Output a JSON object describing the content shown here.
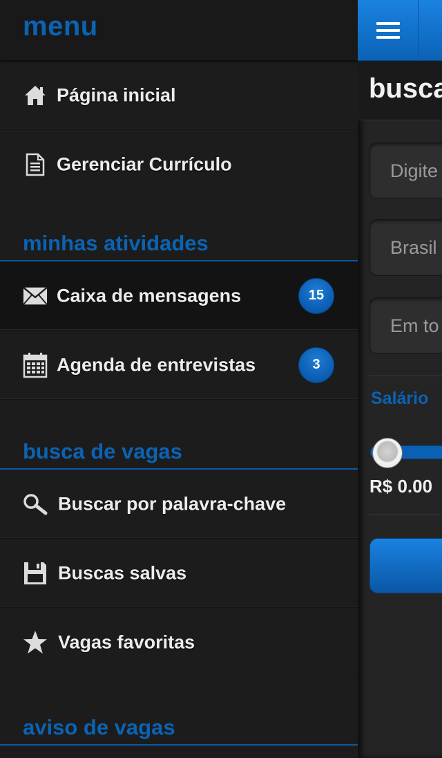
{
  "drawer": {
    "title": "menu",
    "items_top": [
      {
        "label": "Página inicial",
        "icon": "home-icon"
      },
      {
        "label": "Gerenciar Currículo",
        "icon": "document-icon"
      }
    ],
    "sections": [
      {
        "title": "minhas atividades",
        "items": [
          {
            "label": "Caixa de mensagens",
            "icon": "envelope-icon",
            "badge": "15"
          },
          {
            "label": "Agenda de entrevistas",
            "icon": "calendar-icon",
            "badge": "3"
          }
        ]
      },
      {
        "title": "busca de vagas",
        "items": [
          {
            "label": "Buscar por palavra-chave",
            "icon": "search-icon"
          },
          {
            "label": "Buscas salvas",
            "icon": "save-icon"
          },
          {
            "label": "Vagas favoritas",
            "icon": "star-icon"
          }
        ]
      },
      {
        "title": "aviso de vagas"
      }
    ]
  },
  "page": {
    "title": "busca",
    "fields": [
      {
        "placeholder": "Digite"
      },
      {
        "placeholder": "Brasil"
      },
      {
        "placeholder": "Em to"
      }
    ],
    "salary_label": "Salário",
    "salary_value": "R$ 0.00",
    "accent_color": "#0b63b4"
  }
}
